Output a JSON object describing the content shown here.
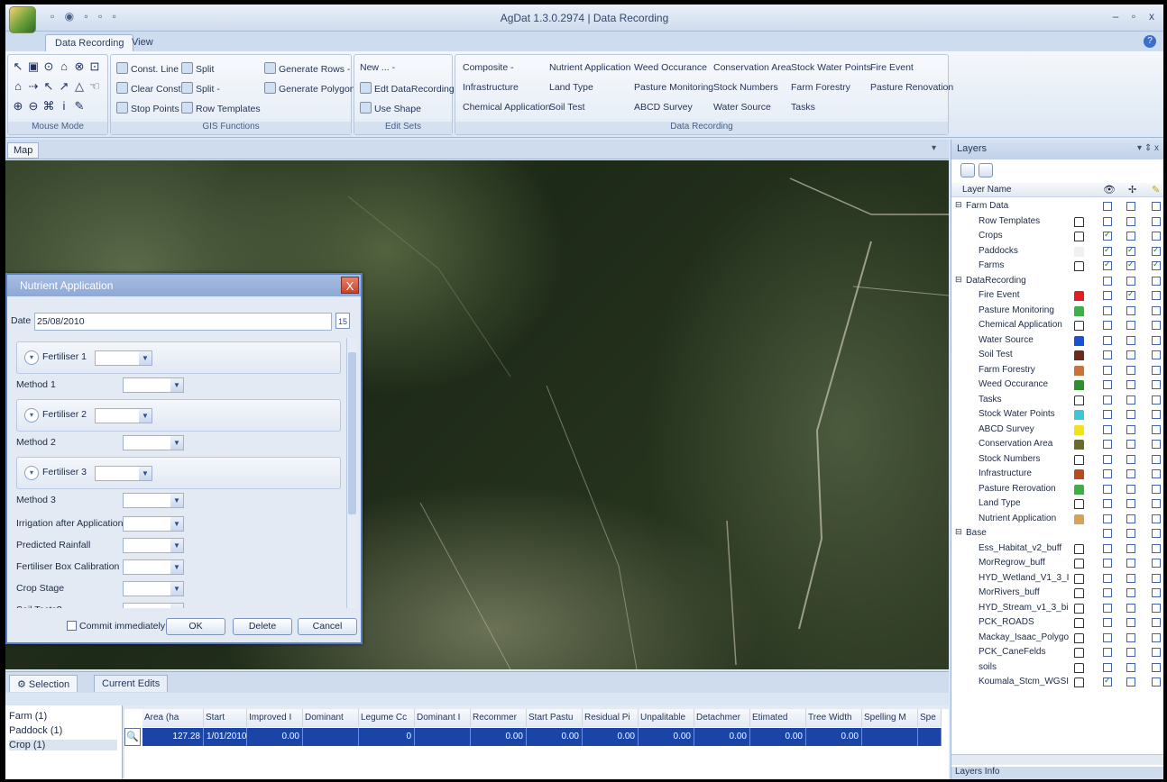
{
  "app": {
    "title": "AgDat 1.3.0.2974 | Data Recording",
    "window_buttons": [
      "–",
      "▫",
      "x"
    ],
    "quick_access": "▫ ◉ ▫ ▫ ▫",
    "help": "?"
  },
  "ribbon": {
    "tabs": [
      "Data Recording",
      "View"
    ],
    "groups": {
      "mouse_mode": {
        "label": "Mouse Mode",
        "tools": [
          "↖",
          "▣",
          "⊙",
          "⌂",
          "⊗",
          "⊡",
          "⌂",
          "⇢",
          "↖",
          "↗",
          "△",
          "☜",
          "⊕",
          "⊖",
          "⌘",
          "i",
          "✎"
        ]
      },
      "gis": {
        "label": "GIS Functions",
        "items": [
          "Const. Line",
          "Clear Const.",
          "Stop Points",
          "Split",
          "Split -",
          "Row Templates",
          "Generate Rows -",
          "Generate Polygon"
        ]
      },
      "edit_sets": {
        "label": "Edit Sets",
        "items": [
          "New ... -",
          "Edt DataRecording",
          "Use Shape"
        ]
      },
      "data_recording": {
        "label": "Data Recording",
        "items": [
          "Composite -",
          "Infrastructure",
          "Chemical Application",
          "Nutrient Application",
          "Land Type",
          "Soil Test",
          "Weed Occurance",
          "Pasture Monitoring",
          "ABCD Survey",
          "Conservation Area",
          "Stock Numbers",
          "Water Source",
          "Stock Water Points",
          "Farm Forestry",
          "Tasks",
          "Fire Event",
          "Pasture Renovation"
        ]
      }
    }
  },
  "map": {
    "tab": "Map",
    "tab_arrow": "▾"
  },
  "dialog": {
    "title": "Nutrient Application",
    "close": "X",
    "date_label": "Date",
    "date_value": "25/08/2010",
    "calendar": "15",
    "sections": [
      "Fertiliser 1",
      "Fertiliser 2",
      "Fertiliser 3"
    ],
    "methods": [
      "Method 1",
      "Method 2",
      "Method 3"
    ],
    "fields": [
      "Irrigation after Application",
      "Predicted Rainfall",
      "Fertiliser Box Calibration",
      "Crop Stage",
      "Soil Tests?"
    ],
    "commit": "Commit immediately",
    "ok": "OK",
    "delete": "Delete",
    "cancel": "Cancel"
  },
  "selection": {
    "tabs": [
      "Selection",
      "Current Edits"
    ],
    "list": [
      "Farm (1)",
      "Paddock (1)",
      "Crop (1)"
    ],
    "columns": [
      "Area (ha",
      "Start",
      "Improved I",
      "Dominant",
      "Legume Cc",
      "Dominant I",
      "Recommer",
      "Start Pastu",
      "Residual Pi",
      "Unpalitable",
      "Detachmer",
      "Etimated",
      "Tree Width",
      "Spelling M",
      "Spe"
    ],
    "row": [
      "127.28",
      "1/01/2010",
      "0.00",
      "",
      "0",
      "",
      "0.00",
      "0.00",
      "0.00",
      "0.00",
      "0.00",
      "0.00",
      "0.00",
      "",
      ""
    ]
  },
  "layers": {
    "title": "Layers",
    "header_controls": "▾ ⇕ x",
    "column_title": "Layer Name",
    "info": "Layers Info",
    "rows": [
      {
        "name": "Farm Data",
        "group": true,
        "checks": [
          false,
          false,
          false
        ]
      },
      {
        "name": "Row Templates",
        "color": "#ffffff",
        "checks": [
          false,
          false,
          false
        ]
      },
      {
        "name": "Crops",
        "color": "#ffffff",
        "checks": [
          true,
          false,
          false
        ]
      },
      {
        "name": "Paddocks",
        "color": "#f0f0f0",
        "checks": [
          true,
          true,
          true
        ]
      },
      {
        "name": "Farms",
        "color": "#ffffff",
        "checks": [
          true,
          true,
          true
        ]
      },
      {
        "name": "DataRecording",
        "group": true,
        "checks": [
          false,
          false,
          false
        ]
      },
      {
        "name": "Fire Event",
        "color": "#e11d1d",
        "checks": [
          false,
          true,
          false
        ]
      },
      {
        "name": "Pasture Monitoring",
        "color": "#3fae49",
        "checks": [
          false,
          false,
          false
        ]
      },
      {
        "name": "Chemical Application",
        "color": "#ffffff",
        "checks": [
          false,
          false,
          false
        ]
      },
      {
        "name": "Water Source",
        "color": "#1c4fd8",
        "checks": [
          false,
          false,
          false
        ]
      },
      {
        "name": "Soil Test",
        "color": "#6b2a1a",
        "checks": [
          false,
          false,
          false
        ]
      },
      {
        "name": "Farm Forestry",
        "color": "#c8733a",
        "checks": [
          false,
          false,
          false
        ]
      },
      {
        "name": "Weed Occurance",
        "color": "#2f8f2f",
        "checks": [
          false,
          false,
          false
        ]
      },
      {
        "name": "Tasks",
        "color": "#ffffff",
        "checks": [
          false,
          false,
          false
        ]
      },
      {
        "name": "Stock Water Points",
        "color": "#3cc7d4",
        "checks": [
          false,
          false,
          false
        ]
      },
      {
        "name": "ABCD Survey",
        "color": "#f2e21b",
        "checks": [
          false,
          false,
          false
        ]
      },
      {
        "name": "Conservation Area",
        "color": "#6a6a2a",
        "checks": [
          false,
          false,
          false
        ]
      },
      {
        "name": "Stock Numbers",
        "color": "#ffffff",
        "checks": [
          false,
          false,
          false
        ]
      },
      {
        "name": "Infrastructure",
        "color": "#b84a1e",
        "checks": [
          false,
          false,
          false
        ]
      },
      {
        "name": "Pasture Rerovation",
        "color": "#3fae49",
        "checks": [
          false,
          false,
          false
        ]
      },
      {
        "name": "Land Type",
        "color": "#ffffff",
        "checks": [
          false,
          false,
          false
        ]
      },
      {
        "name": "Nutrient Application",
        "color": "#d7a35a",
        "checks": [
          false,
          false,
          false
        ]
      },
      {
        "name": "Base",
        "group": true,
        "checks": [
          false,
          false,
          false
        ]
      },
      {
        "name": "Ess_Habitat_v2_buff",
        "color": "#ffffff",
        "checks": [
          false,
          false,
          false
        ]
      },
      {
        "name": "MorRegrow_buff",
        "color": "#ffffff",
        "checks": [
          false,
          false,
          false
        ]
      },
      {
        "name": "HYD_Wetland_V1_3_I",
        "color": "#ffffff",
        "checks": [
          false,
          false,
          false
        ]
      },
      {
        "name": "MorRivers_buff",
        "color": "#ffffff",
        "checks": [
          false,
          false,
          false
        ]
      },
      {
        "name": "HYD_Stream_v1_3_bi",
        "color": "#ffffff",
        "checks": [
          false,
          false,
          false
        ]
      },
      {
        "name": "PCK_ROADS",
        "color": "#ffffff",
        "checks": [
          false,
          false,
          false
        ]
      },
      {
        "name": "Mackay_Isaac_Polygo",
        "color": "#ffffff",
        "checks": [
          false,
          false,
          false
        ]
      },
      {
        "name": "PCK_CaneFelds",
        "color": "#ffffff",
        "checks": [
          false,
          false,
          false
        ]
      },
      {
        "name": "soils",
        "color": "#ffffff",
        "checks": [
          false,
          false,
          false
        ]
      },
      {
        "name": "Koumala_Stcm_WGSI",
        "color": "#ffffff",
        "checks": [
          true,
          false,
          false
        ]
      }
    ]
  }
}
